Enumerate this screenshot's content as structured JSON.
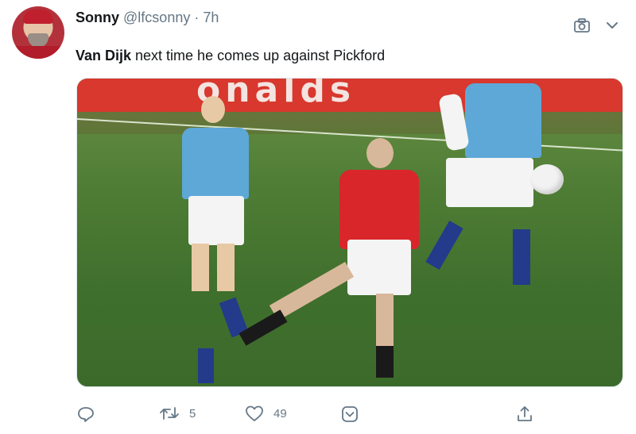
{
  "tweet": {
    "display_name": "Sonny",
    "handle": "@lfcsonny",
    "dot": "·",
    "time": "7h",
    "text_bold": "Van Dijk",
    "text_rest": " next time he comes up against Pickford"
  },
  "media": {
    "billboard_text": "onalds"
  },
  "actions": {
    "retweets": "5",
    "likes": "49"
  },
  "icons": {
    "header": [
      "camera-icon",
      "chevron-down-icon"
    ],
    "actions": [
      "reply-icon",
      "retweet-icon",
      "like-icon",
      "dm-icon",
      "share-icon"
    ]
  },
  "colors": {
    "text": "#14171a",
    "muted": "#657786",
    "border": "#e1e8ed"
  }
}
